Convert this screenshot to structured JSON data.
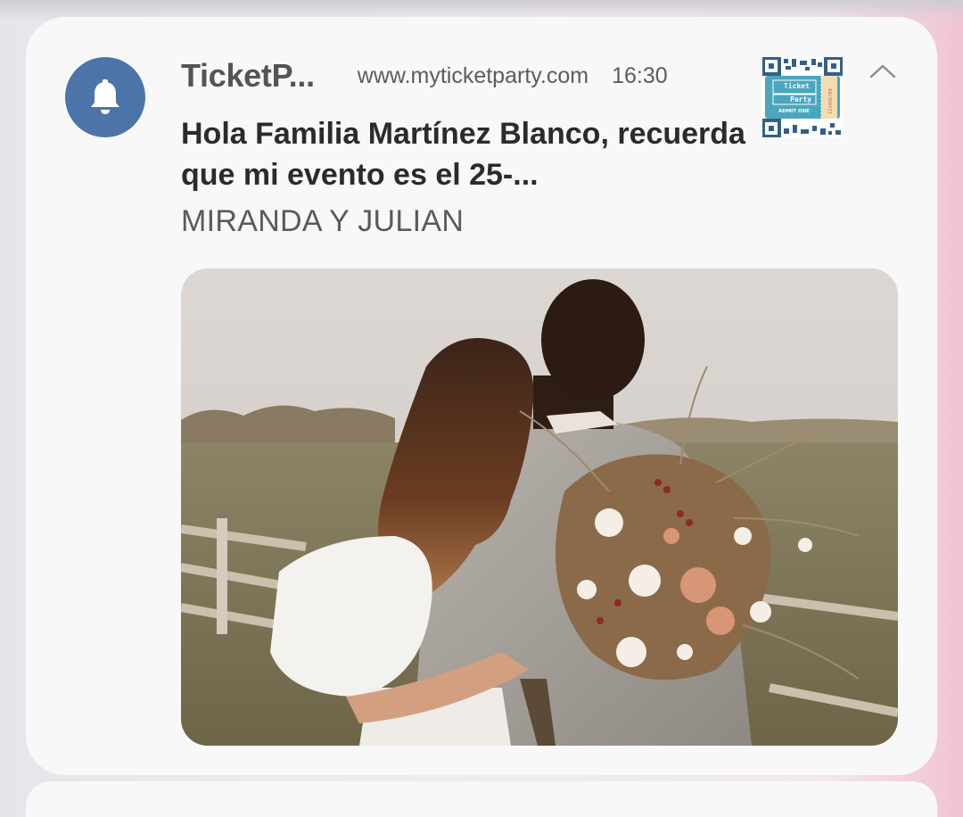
{
  "notification": {
    "app_name": "TicketP...",
    "source_url": "www.myticketparty.com",
    "time": "16:30",
    "title": "Hola Familia Martínez Blanco, recuerda que mi evento es el  25-...",
    "subtitle": "MIRANDA Y JULIAN",
    "app_icon": "bell-icon",
    "expand_icon": "chevron-up-icon",
    "thumbnail": {
      "line1": "Ticket",
      "line2": "Party",
      "admit": "ADMIT ONE",
      "serial": "123456789"
    },
    "image": "wedding couple photo"
  },
  "colors": {
    "app_icon_bg": "#4d74a8",
    "card_bg": "#f8f8f9",
    "thumbnail_teal": "#4aa6bd"
  }
}
